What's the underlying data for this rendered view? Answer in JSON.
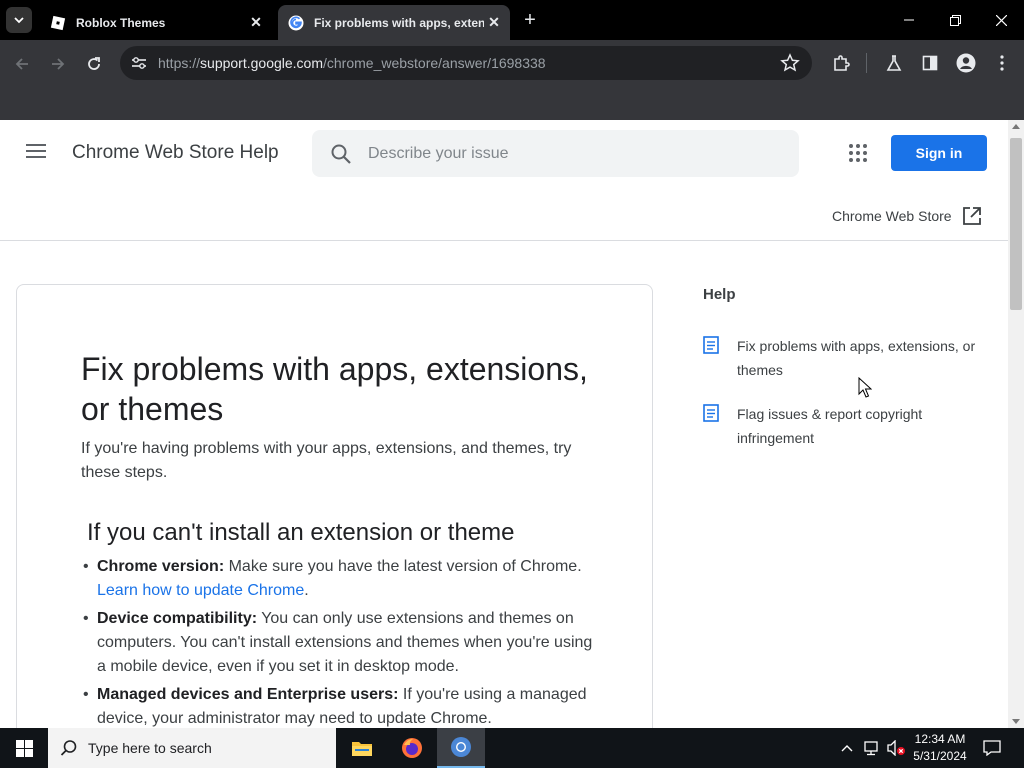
{
  "browser": {
    "tabs": [
      {
        "title": "Roblox Themes",
        "active": false,
        "favicon": "roblox-icon"
      },
      {
        "title": "Fix problems with apps, extensions, or themes",
        "active": true,
        "favicon": "google-icon"
      }
    ],
    "url_scheme": "https://",
    "url_host": "support.google.com",
    "url_path": "/chrome_webstore/answer/1698338"
  },
  "header": {
    "title": "Chrome Web Store Help",
    "search_placeholder": "Describe your issue",
    "signin_label": "Sign in",
    "cws_link_label": "Chrome Web Store"
  },
  "article": {
    "title": "Fix problems with apps, extensions, or themes",
    "intro": "If you're having problems with your apps, extensions, and themes, try these steps.",
    "section_title": "If you can't install an extension or theme",
    "items": [
      {
        "label": "Chrome version:",
        "text": " Make sure you have the latest version of Chrome. ",
        "link": "Learn how to update Chrome",
        "after": "."
      },
      {
        "label": "Device compatibility:",
        "text": " You can only use extensions and themes on computers. You can't install extensions and themes when you're using a mobile device, even if you set it in desktop mode."
      },
      {
        "label": "Managed devices and Enterprise users:",
        "text": " If you're using a managed device, your administrator may need to update Chrome."
      }
    ]
  },
  "sidebar": {
    "heading": "Help",
    "items": [
      {
        "label": "Fix problems with apps, extensions, or themes"
      },
      {
        "label": "Flag issues & report copyright infringement"
      }
    ]
  },
  "taskbar": {
    "search_placeholder": "Type here to search",
    "time": "12:34 AM",
    "date": "5/31/2024"
  },
  "colors": {
    "accent": "#1a73e8",
    "browser_chrome": "#35363a"
  }
}
